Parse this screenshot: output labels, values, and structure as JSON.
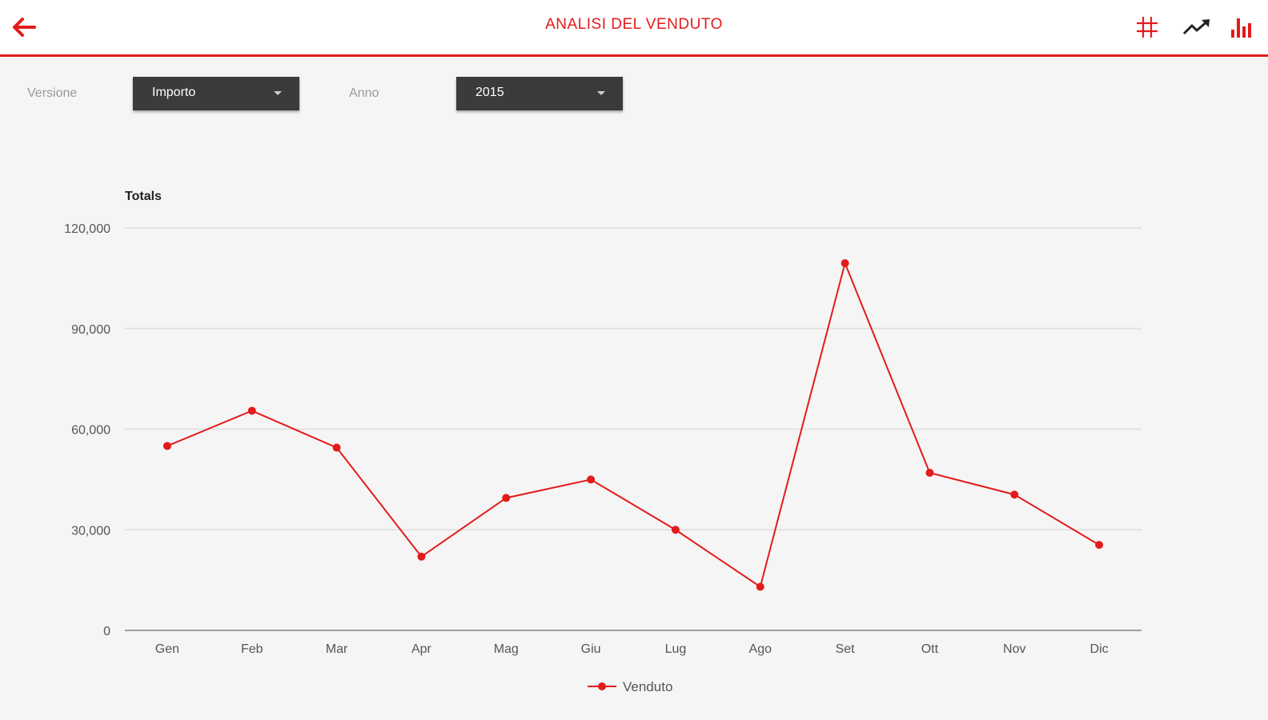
{
  "header": {
    "title": "ANALISI DEL VENDUTO"
  },
  "icons": {
    "back": "arrow-left-icon",
    "grid": "grid-icon",
    "trend": "trending-up-icon",
    "bar": "bar-chart-icon"
  },
  "colors": {
    "accent": "#e31b1b",
    "select_bg": "#3b3b3b"
  },
  "filters": {
    "version_label": "Versione",
    "version_value": "Importo",
    "year_label": "Anno",
    "year_value": "2015"
  },
  "chart_data": {
    "type": "line",
    "ylabel": "Totals",
    "xlabel": "",
    "categories": [
      "Gen",
      "Feb",
      "Mar",
      "Apr",
      "Mag",
      "Giu",
      "Lug",
      "Ago",
      "Set",
      "Ott",
      "Nov",
      "Dic"
    ],
    "ylim": [
      0,
      120000
    ],
    "yticks": [
      0,
      30000,
      60000,
      90000,
      120000
    ],
    "ytick_labels": [
      "0",
      "30,000",
      "60,000",
      "90,000",
      "120,000"
    ],
    "grid": true,
    "legend_position": "bottom-center",
    "series": [
      {
        "name": "Venduto",
        "color": "#e31b1b",
        "values": [
          55000,
          65500,
          54500,
          22000,
          39500,
          45000,
          30000,
          13000,
          109500,
          47000,
          40500,
          25500
        ]
      }
    ]
  }
}
